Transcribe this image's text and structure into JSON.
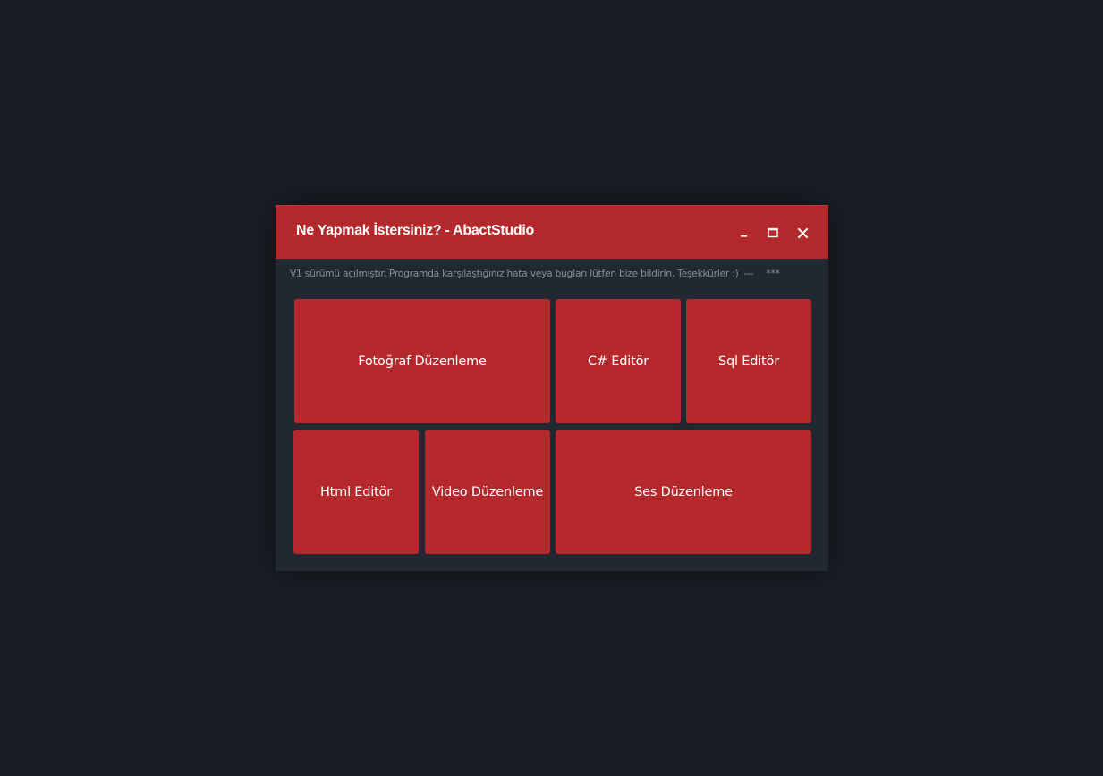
{
  "window": {
    "title": "Ne Yapmak İstersiniz? - AbactStudio",
    "controls": {
      "minimize_icon": "minimize-icon",
      "maximize_icon": "maximize-icon",
      "close_icon": "close-icon"
    },
    "notice": {
      "text": "V1 sürümü açılmıştır. Programda karşılaştığınız hata veya bugları lütfen bize bildirin. Teşekkürler :)",
      "separator": "---",
      "stars": "***"
    },
    "tiles": {
      "photo_editing": "Fotoğraf Düzenleme",
      "csharp_editor": "C# Editör",
      "sql_editor": "Sql Editör",
      "html_editor": "Html Editör",
      "video_editing": "Video Düzenleme",
      "audio_editing": "Ses Düzenleme"
    }
  },
  "colors": {
    "background": "#191e25",
    "window_body": "#222831",
    "accent_red": "#b5282c",
    "text_white": "#ffffff",
    "notice_gray": "#8a9099"
  }
}
